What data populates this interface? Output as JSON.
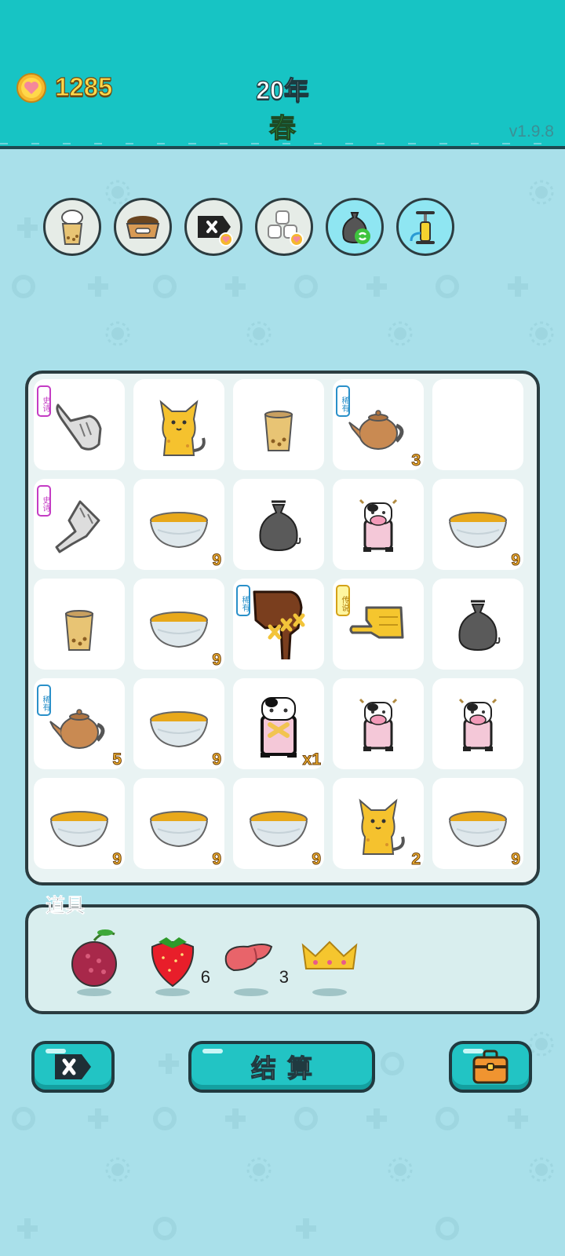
{
  "header": {
    "coins": "1285",
    "year": "20年",
    "season": "春",
    "version": "v1.9.8"
  },
  "tools": [
    "bubble-tea-cup-icon",
    "pet-food-bowl-icon",
    "cancel-tag-icon",
    "sugar-cubes-icon",
    "recycle-trash-bag-icon",
    "air-pump-icon"
  ],
  "board": {
    "rows": [
      [
        {
          "item": "gray-pointing-hand",
          "tag": "史诗",
          "count": ""
        },
        {
          "item": "orange-cat",
          "tag": "",
          "count": ""
        },
        {
          "item": "bubble-tea-cup",
          "tag": "",
          "count": ""
        },
        {
          "item": "teapot",
          "tag": "稀有",
          "count": "3"
        },
        {
          "item": "empty",
          "tag": "",
          "count": ""
        }
      ],
      [
        {
          "item": "gray-pointing-hand-down",
          "tag": "史诗",
          "count": ""
        },
        {
          "item": "tea-bowl",
          "tag": "",
          "count": "9"
        },
        {
          "item": "trash-bag",
          "tag": "",
          "count": ""
        },
        {
          "item": "cow",
          "tag": "",
          "count": ""
        },
        {
          "item": "tea-bowl",
          "tag": "",
          "count": "9"
        }
      ],
      [
        {
          "item": "bubble-tea-cup",
          "tag": "",
          "count": ""
        },
        {
          "item": "tea-bowl",
          "tag": "",
          "count": "9"
        },
        {
          "item": "brown-hand-with-x",
          "tag": "稀有",
          "count": ""
        },
        {
          "item": "yellow-pointing-hand",
          "tag": "传说",
          "count": ""
        },
        {
          "item": "trash-bag",
          "tag": "",
          "count": ""
        }
      ],
      [
        {
          "item": "teapot",
          "tag": "稀有",
          "count": "5"
        },
        {
          "item": "tea-bowl",
          "tag": "",
          "count": "9"
        },
        {
          "item": "cow-with-x",
          "tag": "",
          "count": "x1"
        },
        {
          "item": "cow",
          "tag": "",
          "count": ""
        },
        {
          "item": "cow",
          "tag": "",
          "count": ""
        }
      ],
      [
        {
          "item": "tea-bowl",
          "tag": "",
          "count": "9"
        },
        {
          "item": "tea-bowl",
          "tag": "",
          "count": "9"
        },
        {
          "item": "tea-bowl",
          "tag": "",
          "count": "9"
        },
        {
          "item": "orange-cat",
          "tag": "",
          "count": "2"
        },
        {
          "item": "tea-bowl",
          "tag": "",
          "count": "9"
        }
      ]
    ]
  },
  "props": {
    "label": "道具",
    "items": [
      {
        "item": "bayberry-icon",
        "count": ""
      },
      {
        "item": "strawberry-icon",
        "count": "6"
      },
      {
        "item": "liver-icon",
        "count": "3"
      },
      {
        "item": "crown-icon",
        "count": ""
      }
    ]
  },
  "buttons": {
    "cancel_icon": "close-tag-icon",
    "settle_label": "结算",
    "bag_icon": "briefcase-icon"
  },
  "colors": {
    "header": "#17c4c4",
    "background": "#a9e0ea",
    "coin_text": "#ffd84a",
    "season_text": "#3ed94a",
    "button": "#22c4c4"
  }
}
